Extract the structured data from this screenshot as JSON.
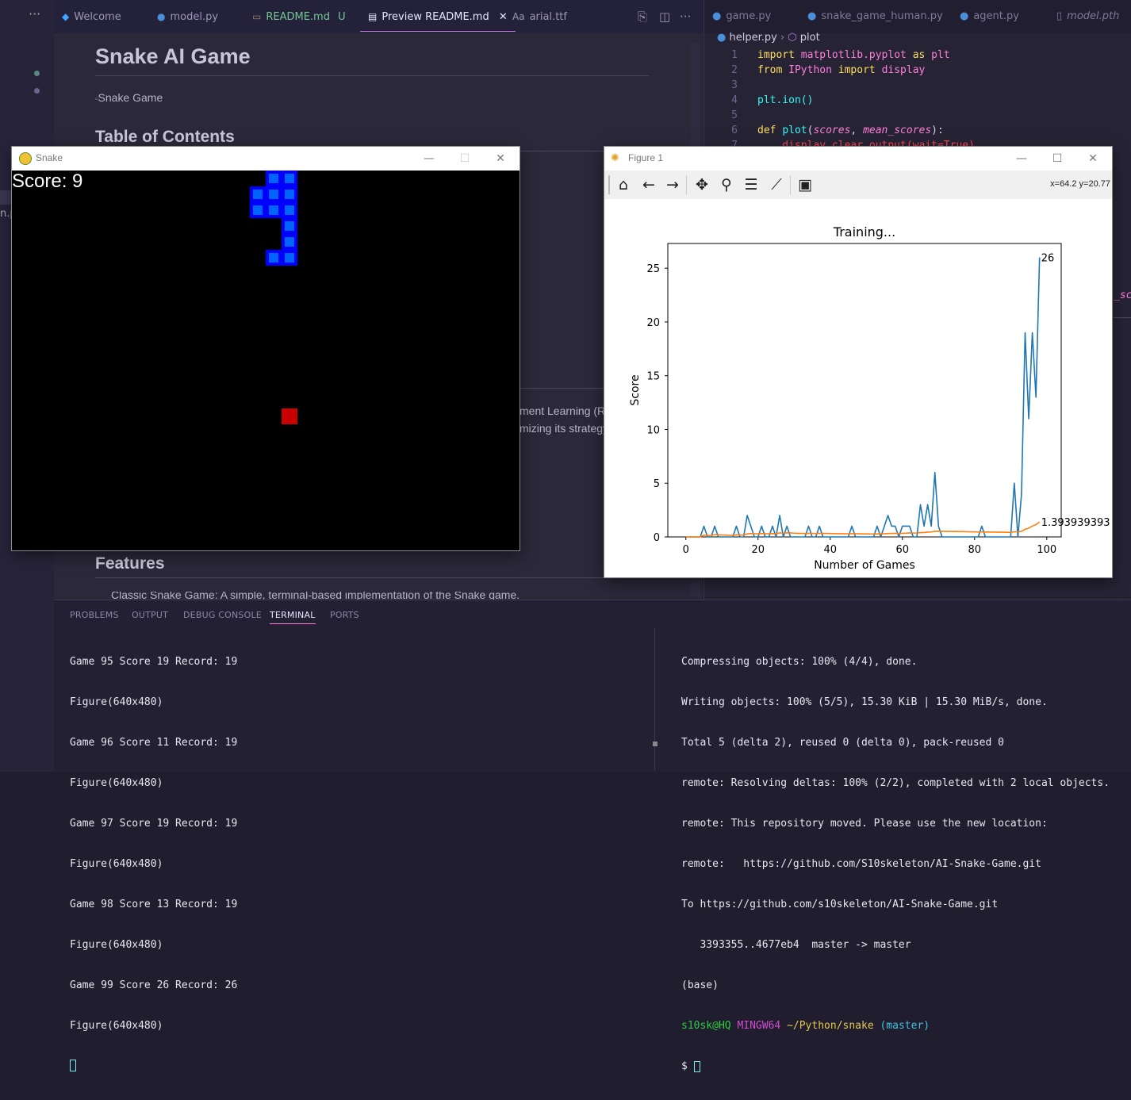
{
  "vscode": {
    "left_tabs": [
      {
        "label": "Welcome",
        "icon": "vscode-icon"
      },
      {
        "label": "model.py",
        "icon": "python-icon"
      },
      {
        "label": "README.md",
        "badge": "U",
        "icon": "markdown-icon"
      },
      {
        "label": "Preview README.md",
        "icon": "preview-icon",
        "active": true
      },
      {
        "label": "arial.ttf",
        "icon": "font-icon"
      }
    ],
    "right_tabs": [
      "game.py",
      "snake_game_human.py",
      "agent.py",
      "model.pth"
    ],
    "breadcrumb": {
      "file": "helper.py",
      "symbol": "plot"
    },
    "code_lines": [
      {
        "n": "1"
      },
      {
        "n": "2"
      },
      {
        "n": "3"
      },
      {
        "n": "4"
      },
      {
        "n": "5"
      },
      {
        "n": "6"
      },
      {
        "n": "7"
      }
    ],
    "code_tokens": {
      "import": "import",
      "matplotlib": "matplotlib.pyplot",
      "as": "as",
      "plt": "plt",
      "from": "from",
      "ipython": "IPython",
      "display": "display",
      "ion": "plt.ion()",
      "def": "def",
      "plot": "plot",
      "lparen": "(",
      "scores": "scores",
      "comma": ", ",
      "mean_scores": "mean_scores",
      "rparen": "):",
      "line7": "    display.clear_output(wait=True)"
    },
    "right_overflow": "_sc"
  },
  "preview": {
    "title": "Snake AI Game",
    "image_alt": "Snake Game",
    "toc": "Table of Contents",
    "partial_1": "ment Learning (RL",
    "partial_2": "mizing its strategy",
    "features": "Features",
    "features_item": "Classic Snake Game: A simple, terminal-based implementation of the Snake game."
  },
  "panel": {
    "tabs": [
      "PROBLEMS",
      "OUTPUT",
      "DEBUG CONSOLE",
      "TERMINAL",
      "PORTS"
    ],
    "active_tab": "TERMINAL",
    "terminal_left": [
      "Game 95 Score 19 Record: 19",
      "Figure(640x480)",
      "Game 96 Score 11 Record: 19",
      "Figure(640x480)",
      "Game 97 Score 19 Record: 19",
      "Figure(640x480)",
      "Game 98 Score 13 Record: 19",
      "Figure(640x480)",
      "Game 99 Score 26 Record: 26",
      "Figure(640x480)"
    ],
    "terminal_right": [
      "Compressing objects: 100% (4/4), done.",
      "Writing objects: 100% (5/5), 15.30 KiB | 15.30 MiB/s, done.",
      "Total 5 (delta 2), reused 0 (delta 0), pack-reused 0",
      "remote: Resolving deltas: 100% (2/2), completed with 2 local objects.",
      "remote: This repository moved. Please use the new location:",
      "remote:   https://github.com/S10skeleton/AI-Snake-Game.git",
      "To https://github.com/s10skeleton/AI-Snake-Game.git",
      "   3393355..4677eb4  master -> master",
      "(base)"
    ],
    "prompt": {
      "user": "s10sk@HQ",
      "sys": "MINGW64",
      "path": "~/Python/snake",
      "branch": "(master)",
      "dollar": "$"
    }
  },
  "snake_window": {
    "title": "Snake",
    "score_label": "Score: 9",
    "segments": [
      {
        "col": 16,
        "row": 0
      },
      {
        "col": 17,
        "row": 0
      },
      {
        "col": 15,
        "row": 1
      },
      {
        "col": 16,
        "row": 1
      },
      {
        "col": 17,
        "row": 1
      },
      {
        "col": 15,
        "row": 2
      },
      {
        "col": 16,
        "row": 2
      },
      {
        "col": 17,
        "row": 2
      },
      {
        "col": 17,
        "row": 3
      },
      {
        "col": 17,
        "row": 4
      },
      {
        "col": 16,
        "row": 5
      },
      {
        "col": 17,
        "row": 5
      }
    ],
    "food": {
      "col": 17,
      "row": 15
    },
    "colors": {
      "body": "#0000ff",
      "inner": "#0064ff",
      "food": "#c80000",
      "bg": "#000000"
    }
  },
  "figure_window": {
    "title": "Figure 1",
    "coords": "x=64.2 y=20.77",
    "tools": [
      "home-icon",
      "back-arrow-icon",
      "forward-arrow-icon",
      "pan-icon",
      "zoom-icon",
      "configure-subplots-icon",
      "edit-axes-icon",
      "save-icon"
    ]
  },
  "chart_data": {
    "type": "line",
    "title": "Training...",
    "xlabel": "Number of Games",
    "ylabel": "Score",
    "xlim": [
      -5,
      104
    ],
    "ylim": [
      0,
      27.3
    ],
    "xticks": [
      0,
      20,
      40,
      60,
      80,
      100
    ],
    "yticks": [
      0,
      5,
      10,
      15,
      20,
      25
    ],
    "series": [
      {
        "color": "#1f77b4",
        "values": [
          0,
          0,
          0,
          0,
          0,
          1,
          0,
          0,
          1,
          0,
          0,
          0,
          0,
          0,
          1,
          0,
          0,
          2,
          1,
          0,
          0,
          1,
          0,
          0,
          1,
          0,
          2,
          0,
          1,
          0,
          0,
          0,
          0,
          0,
          1,
          0,
          0,
          1,
          0,
          0,
          0,
          0,
          0,
          0,
          0,
          0,
          1,
          0,
          0,
          0,
          0,
          0,
          0,
          1,
          0,
          1,
          2,
          1,
          1,
          0,
          1,
          1,
          1,
          0,
          0,
          3,
          1,
          3,
          1,
          6,
          1,
          0,
          0,
          0,
          0,
          0,
          0,
          0,
          0,
          0,
          0,
          0,
          1,
          0,
          0,
          0,
          0,
          0,
          0,
          0,
          0,
          5,
          0,
          4,
          19,
          11,
          19,
          13,
          26
        ],
        "end_label": "26"
      },
      {
        "color": "#ff7f0e",
        "values": [
          0,
          0,
          0,
          0,
          0,
          0.17,
          0.14,
          0.12,
          0.22,
          0.2,
          0.18,
          0.17,
          0.15,
          0.14,
          0.2,
          0.19,
          0.18,
          0.28,
          0.32,
          0.3,
          0.29,
          0.32,
          0.3,
          0.29,
          0.31,
          0.3,
          0.37,
          0.36,
          0.38,
          0.37,
          0.35,
          0.34,
          0.33,
          0.32,
          0.34,
          0.33,
          0.32,
          0.34,
          0.33,
          0.33,
          0.32,
          0.31,
          0.3,
          0.3,
          0.29,
          0.29,
          0.3,
          0.3,
          0.29,
          0.28,
          0.28,
          0.27,
          0.27,
          0.28,
          0.27,
          0.29,
          0.32,
          0.33,
          0.34,
          0.33,
          0.34,
          0.35,
          0.37,
          0.36,
          0.36,
          0.4,
          0.41,
          0.45,
          0.46,
          0.52,
          0.53,
          0.52,
          0.51,
          0.51,
          0.5,
          0.5,
          0.49,
          0.49,
          0.48,
          0.47,
          0.47,
          0.46,
          0.47,
          0.46,
          0.46,
          0.45,
          0.45,
          0.44,
          0.44,
          0.43,
          0.43,
          0.48,
          0.48,
          0.52,
          0.71,
          0.82,
          1.01,
          1.14,
          1.3939393939
        ],
        "end_label": "1.393939393"
      }
    ],
    "grid": false
  }
}
